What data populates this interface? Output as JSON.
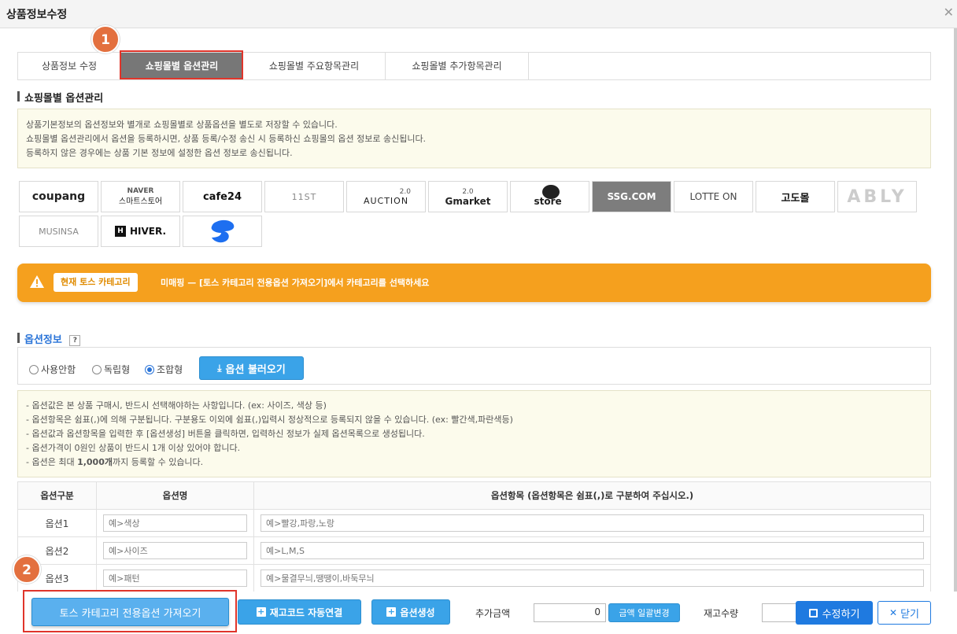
{
  "window": {
    "title": "상품정보수정"
  },
  "tabs": [
    {
      "label": "상품정보 수정"
    },
    {
      "label": "쇼핑몰별 옵션관리"
    },
    {
      "label": "쇼핑몰별 주요항목관리"
    },
    {
      "label": "쇼핑몰별 추가항목관리"
    }
  ],
  "badges": {
    "one": "1",
    "two": "2"
  },
  "section_mall_option": {
    "title": "쇼핑몰별 옵션관리",
    "notice": [
      "상품기본정보의 옵션정보와 별개로 쇼핑몰별로 상품옵션을 별도로 저장할 수 있습니다.",
      "쇼핑몰별 옵션관리에서 옵션을 등록하시면, 상품 등록/수정 송신 시 등록하신 쇼핑몰의 옵션 정보로 송신됩니다.",
      "등록하지 않은 경우에는 상품 기본 정보에 설정한 옵션 정보로 송신됩니다."
    ]
  },
  "malls": {
    "coupang": "coupang",
    "naver1": "NAVER",
    "naver2": "스마트스토어",
    "cafe24": "cafe24",
    "st": "11ST",
    "auction": "AUCTION",
    "auction_v": "2.0",
    "gmarket": "Gmarket",
    "gmarket_v": "2.0",
    "store": "store",
    "ssg": "SSG.COM",
    "lotte": "LOTTE ON",
    "godomall": "고도몰",
    "ably": "ABLY",
    "musinsa": "MUSINSA",
    "hiver": "HIVER.",
    "hiver_h": "H"
  },
  "alert": {
    "chip": "현재 토스 카테고리",
    "message": "미매핑 — [토스 카테고리 전용옵션 가져오기]에서 카테고리를 선택하세요"
  },
  "option_info": {
    "title": "옵션정보",
    "help": "?",
    "radios": [
      {
        "label": "사용안함",
        "checked": false
      },
      {
        "label": "독립형",
        "checked": false
      },
      {
        "label": "조합형",
        "checked": true
      }
    ],
    "load_button": "옵션 불러오기",
    "notes": [
      "- 옵션값은 본 상품 구매시, 반드시 선택해야하는 사항입니다. (ex: 사이즈, 색상 등)",
      "- 옵션항목은 쉼표(,)에 의해 구분됩니다. 구분용도 이외에 쉼표(,)입력시 정상적으로 등록되지 않을 수 있습니다. (ex: 빨간색,파란색등)",
      "- 옵션값과 옵션항목을 입력한 후 [옵션생성] 버튼을 클릭하면, 입력하신 정보가 실제 옵션목록으로 생성됩니다.",
      "- 옵션가격이 0원인 상품이 반드시 1개 이상 있어야 합니다."
    ],
    "last_note_pre": "- 옵션은 최대 ",
    "last_note_bold": "1,000개",
    "last_note_post": "까지 등록할 수 있습니다."
  },
  "option_table": {
    "headers": [
      "옵션구분",
      "옵션명",
      "옵션항목 (옵션항목은 쉼표(,)로 구분하여 주십시오.)"
    ],
    "rows": [
      {
        "label": "옵션1",
        "name_ph": "예>색상",
        "items_ph": "예>빨강,파랑,노랑"
      },
      {
        "label": "옵션2",
        "name_ph": "예>사이즈",
        "items_ph": "예>L,M,S"
      },
      {
        "label": "옵션3",
        "name_ph": "예>패턴",
        "items_ph": "예>물결무늬,땡땡이,바둑무늬"
      }
    ]
  },
  "bottom": {
    "toss_button": "토스 카테고리 전용옵션 가져오기",
    "stock_button": "재고코드 자동연결",
    "create_button": "옵션생성",
    "add_price_label": "추가금액",
    "add_price_value": "0",
    "bulk_button": "금액 일괄변경",
    "stock_label": "재고수량",
    "save_button": "수정하기",
    "close_button": "닫기"
  },
  "colors": {
    "accent": "#3aa3e8",
    "alert": "#f5a01e",
    "highlight": "#e0352b",
    "badge": "#e3703f"
  }
}
